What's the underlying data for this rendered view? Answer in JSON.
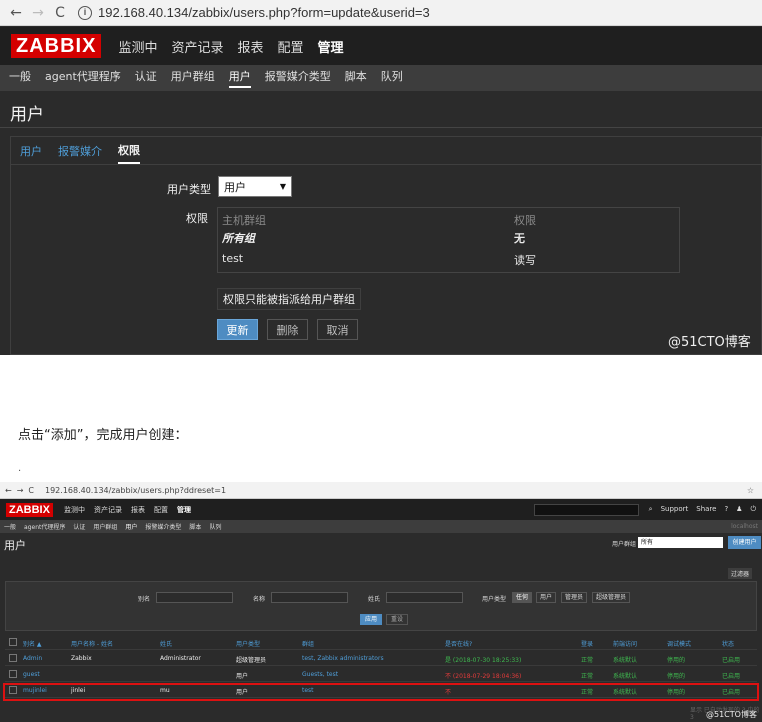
{
  "screenshot1": {
    "browser": {
      "back": "←",
      "forward": "→",
      "reload": "C",
      "url": "192.168.40.134/zabbix/users.php?form=update&userid=3"
    },
    "logo": "ZABBIX",
    "main_menu": [
      "监测中",
      "资产记录",
      "报表",
      "配置",
      "管理"
    ],
    "sub_menu": [
      "一般",
      "agent代理程序",
      "认证",
      "用户群组",
      "用户",
      "报警媒介类型",
      "脚本",
      "队列"
    ],
    "page_title": "用户",
    "tabs": [
      "用户",
      "报警媒介",
      "权限"
    ],
    "form": {
      "user_type_label": "用户类型",
      "user_type_value": "用户",
      "permissions_label": "权限",
      "perm_headers": [
        "主机群组",
        "权限"
      ],
      "perm_rows": [
        {
          "group": "所有组",
          "perm": "无"
        },
        {
          "group": "test",
          "perm": "读写"
        }
      ],
      "note": "权限只能被指派给用户群组",
      "buttons": {
        "update": "更新",
        "delete": "删除",
        "cancel": "取消"
      }
    },
    "watermark": "@51CTO博客"
  },
  "instruction": "点击“添加”，完成用户创建：",
  "dot": ".",
  "screenshot2": {
    "browser": {
      "back": "←",
      "forward": "→",
      "reload": "C",
      "url": "192.168.40.134/zabbix/users.php?ddreset=1",
      "star": "☆"
    },
    "logo": "ZABBIX",
    "main_menu": [
      "监测中",
      "资产记录",
      "报表",
      "配置",
      "管理"
    ],
    "right_items": [
      "Support",
      "Share",
      "?"
    ],
    "sub_menu": [
      "一般",
      "agent代理程序",
      "认证",
      "用户群组",
      "用户",
      "报警媒介类型",
      "脚本",
      "队列"
    ],
    "server_name": "localhost",
    "page_title": "用户",
    "user_group_label": "用户群组",
    "user_group_value": "所有",
    "create_button": "创建用户",
    "filter_label": "过滤器",
    "filter": {
      "alias_label": "别名",
      "name_label": "名称",
      "surname_label": "姓氏",
      "type_label": "用户类型",
      "type_options": [
        "任何",
        "用户",
        "管理员",
        "超级管理员"
      ],
      "apply": "应用",
      "reset": "重设"
    },
    "table": {
      "headers": [
        "别名 ▲",
        "用户名称 - 姓名",
        "姓氏",
        "用户类型",
        "群组",
        "是否在线?",
        "登录",
        "前端访问",
        "调试模式",
        "状态"
      ],
      "rows": [
        [
          "Admin",
          "Zabbix",
          "Administrator",
          "超级管理员",
          "test, Zabbix administrators",
          "是 (2018-07-30 18:25:33)",
          "正常",
          "系统默认",
          "停用的",
          "已启用"
        ],
        [
          "guest",
          "",
          "",
          "用户",
          "Guests, test",
          "不 (2018-07-29 18:04:36)",
          "正常",
          "系统默认",
          "停用的",
          "已启用"
        ],
        [
          "mujinlei",
          "jinlei",
          "mu",
          "用户",
          "test",
          "不",
          "正常",
          "系统默认",
          "停用的",
          "已启用"
        ]
      ]
    },
    "footer": "显示 已自动发现的 3 中的 3",
    "watermark": "@51CTO博客"
  }
}
